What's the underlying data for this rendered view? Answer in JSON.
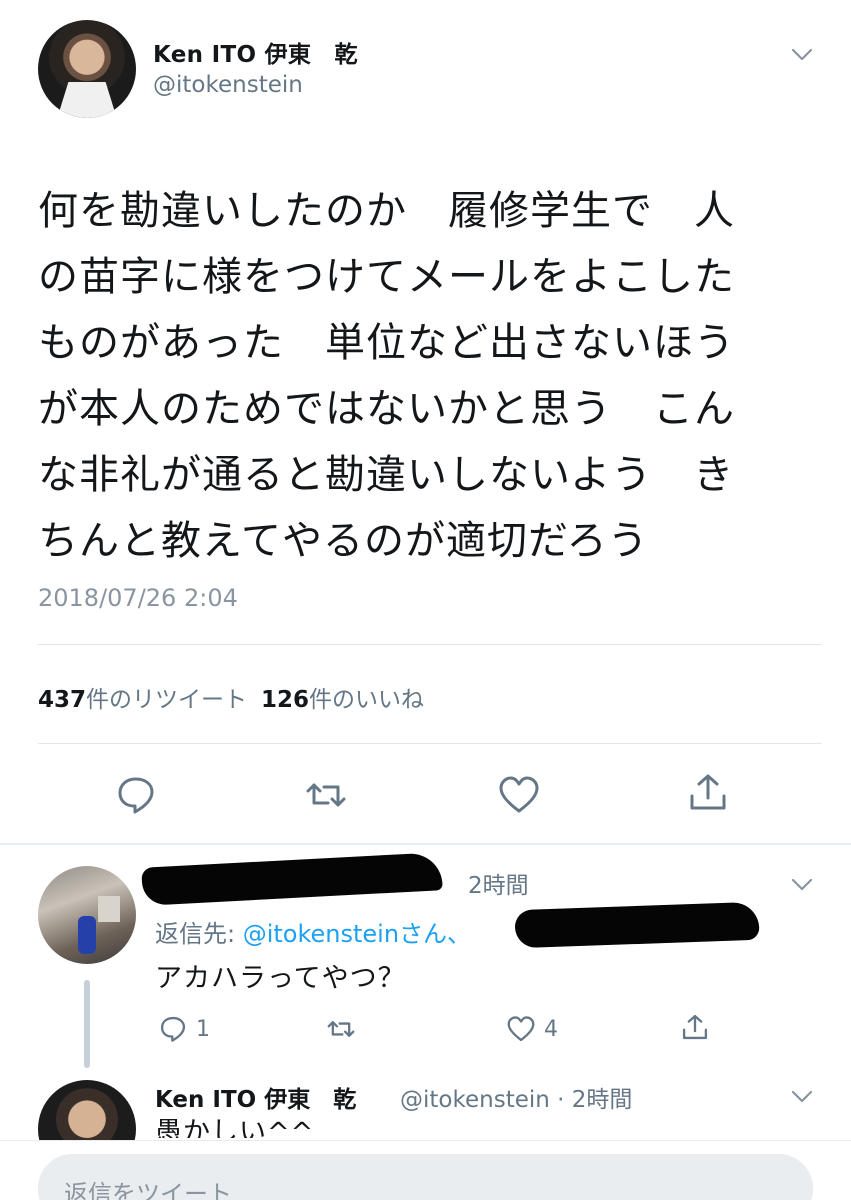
{
  "main_tweet": {
    "author_name": "Ken ITO 伊東　乾",
    "author_handle": "@itokenstein",
    "text": "何を勘違いしたのか　履修学生で　人\nの苗字に様をつけてメールをよこした\nものがあった　単位など出さないほう\nが本人のためではないかと思う　こん\nな非礼が通ると勘違いしないよう　き\nちんと教えてやるのが適切だろう",
    "timestamp": "2018/07/26 2:04",
    "retweet_count": "437",
    "retweet_label": "件のリツイート",
    "like_count": "126",
    "like_label": "件のいいね"
  },
  "reply": {
    "time": "2時間",
    "reply_to_prefix": "返信先: ",
    "reply_to_mention": "@itokenstein",
    "reply_to_suffix": "さん、",
    "text": "アカハラってやつ？",
    "reply_count": "1",
    "like_count": "4"
  },
  "nested_reply": {
    "author_name": "Ken ITO 伊東　乾",
    "meta": "@itokenstein · 2時間",
    "text": "愚かしい^^"
  },
  "compose": {
    "placeholder": "返信をツイート"
  },
  "icons": {
    "chevron": "chevron-down-icon",
    "reply": "reply-icon",
    "retweet": "retweet-icon",
    "like": "heart-icon",
    "share": "share-icon"
  },
  "colors": {
    "text_primary": "#14171a",
    "text_secondary": "#657786",
    "link": "#1da1f2",
    "divider": "#e1e8ed"
  }
}
